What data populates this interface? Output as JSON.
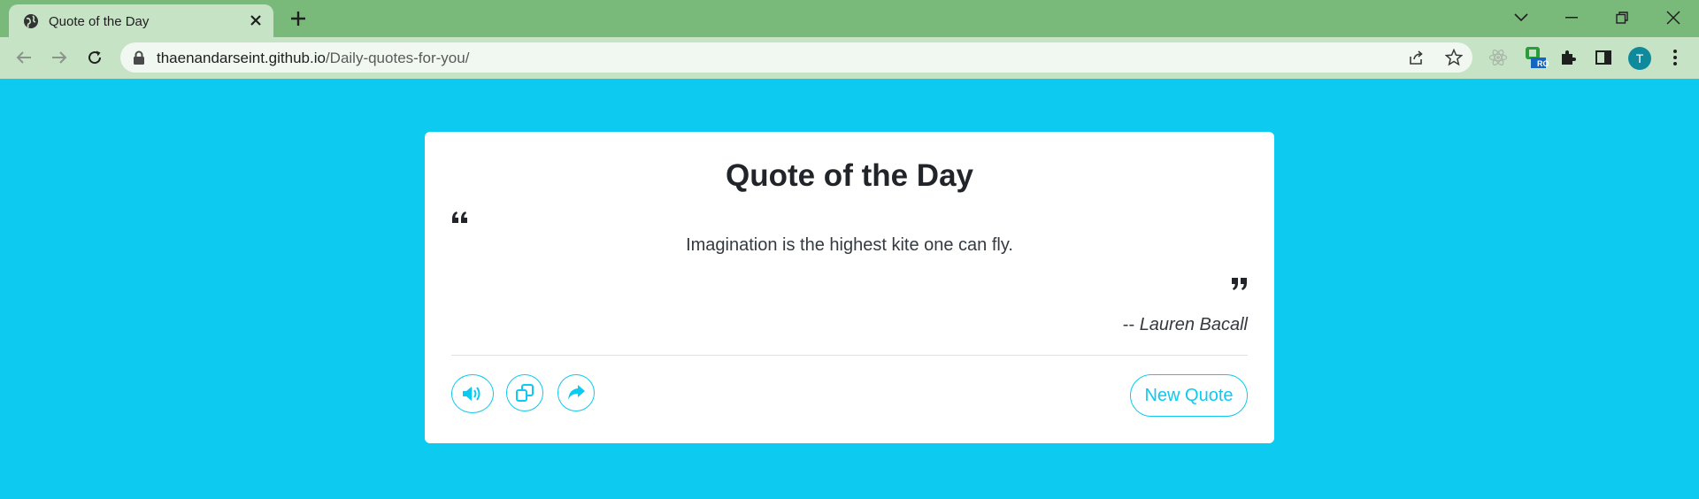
{
  "browser": {
    "tab": {
      "title": "Quote of the Day"
    },
    "address": {
      "host": "thaenandarseint.github.io",
      "path": "/Daily-quotes-for-you/"
    },
    "extension_badge": "RO",
    "profile_initial": "T"
  },
  "page": {
    "title": "Quote of the Day",
    "quote": "Imagination is the highest kite one can fly.",
    "author_prefix": "-- ",
    "author": "Lauren Bacall",
    "new_quote_label": "New Quote"
  },
  "colors": {
    "page_background": "#0dcaf0",
    "accent": "#0dcaf0",
    "browser_frame": "#79b979",
    "browser_toolbar": "#c6e3c6"
  },
  "icons": {
    "speak": "volume-icon",
    "copy": "copy-icon",
    "share": "share-icon"
  }
}
